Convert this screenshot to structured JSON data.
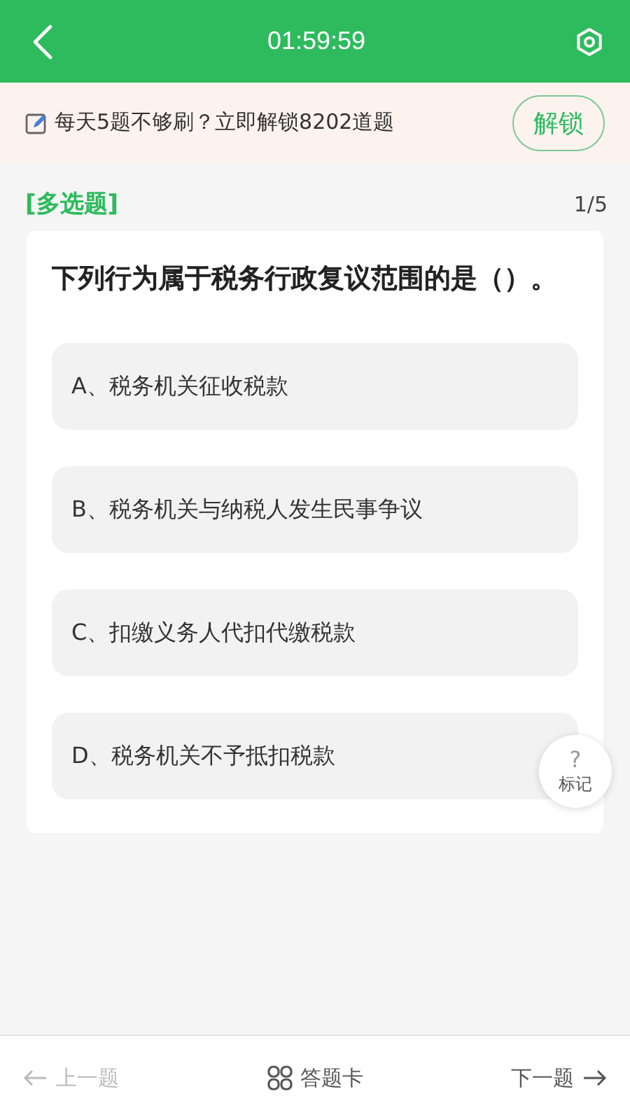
{
  "header": {
    "timer": "01:59:59"
  },
  "banner": {
    "text": "每天5题不够刷？立即解锁8202道题",
    "button": "解锁"
  },
  "question": {
    "type": "[多选题]",
    "progress": "1/5",
    "text": "下列行为属于税务行政复议范围的是（）。",
    "options": [
      {
        "label": "A、税务机关征收税款",
        "selected": false
      },
      {
        "label": "B、税务机关与纳税人发生民事争议",
        "selected": false
      },
      {
        "label": "C、扣缴义务人代扣代缴税款",
        "selected": false
      },
      {
        "label": "D、税务机关不予抵扣税款",
        "selected": false
      }
    ]
  },
  "mark_button": {
    "icon": "?",
    "label": "标记"
  },
  "bottom_nav": [
    {
      "kind": "prev",
      "label": "上一题",
      "disabled": true
    },
    {
      "kind": "card",
      "label": "答题卡",
      "disabled": false
    },
    {
      "kind": "next",
      "label": "下一题",
      "disabled": false
    }
  ]
}
